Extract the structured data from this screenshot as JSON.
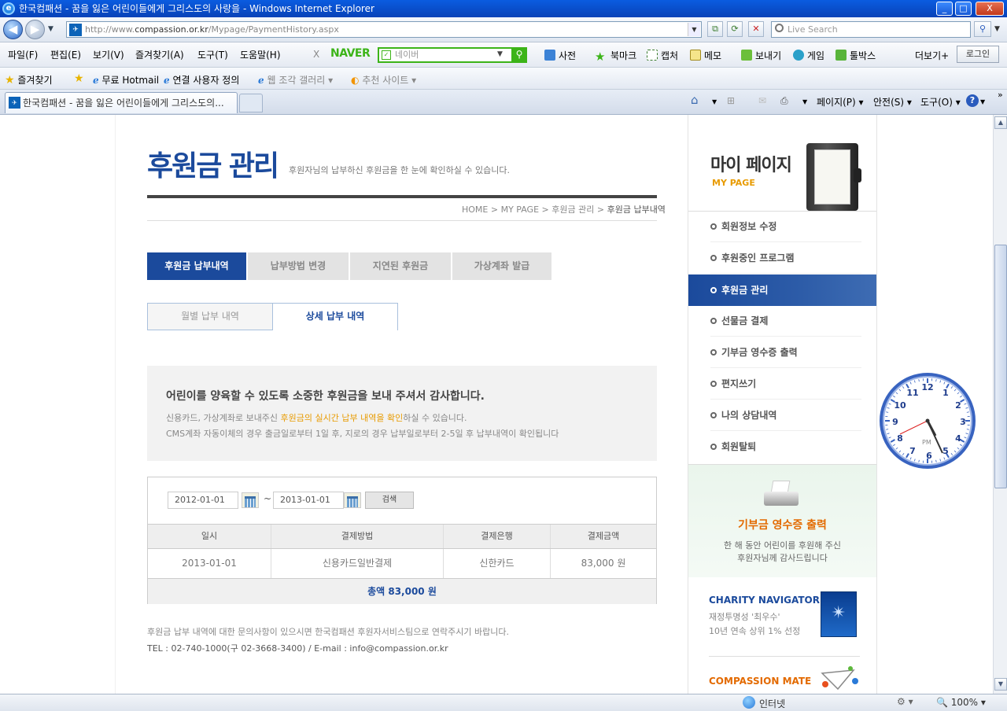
{
  "window": {
    "title": "한국컴패션 - 꿈을 잃은 어린이들에게 그리스도의 사랑을 - Windows Internet Explorer",
    "min": "_",
    "max": "□",
    "close": "X"
  },
  "address": {
    "url_pre": "http://www.",
    "url_host": "compassion.or.kr",
    "url_path": "/Mypage/PaymentHistory.aspx",
    "search_placeholder": "Live Search"
  },
  "menu": [
    "파일(F)",
    "편집(E)",
    "보기(V)",
    "즐겨찾기(A)",
    "도구(T)",
    "도움말(H)"
  ],
  "naver": {
    "close": "X",
    "logo": "NAVER",
    "placeholder": "네이버",
    "tools": [
      "사전",
      "북마크",
      "캡처",
      "메모",
      "보내기",
      "게임",
      "툴박스"
    ],
    "more": "더보기+",
    "login": "로그인"
  },
  "favorites": {
    "label": "즐겨찾기",
    "items": [
      "무료 Hotmail",
      "연결 사용자 정의",
      "웹 조각 갤러리",
      "추천 사이트"
    ]
  },
  "tab": {
    "title": "한국컴패션 - 꿈을 잃은 어린이들에게 그리스도의...",
    "commands": [
      "페이지(P)",
      "안전(S)",
      "도구(O)"
    ]
  },
  "page": {
    "title": "후원금 관리",
    "subtitle": "후원자님의 납부하신 후원금을 한 눈에 확인하실 수 있습니다.",
    "breadcrumb": [
      "HOME",
      "MY PAGE",
      "후원금 관리"
    ],
    "breadcrumb_current": "후원금 납부내역",
    "tabs": [
      "후원금 납부내역",
      "납부방법 변경",
      "지연된 후원금",
      "가상계좌 발급"
    ],
    "subtabs": [
      "월별 납부 내역",
      "상세 납부 내역"
    ],
    "notice": {
      "heading": "어린이를 양육할 수 있도록 소중한 후원금을 보내 주셔서 감사합니다.",
      "line1_pre": "신용카드, 가상계좌로 보내주신 ",
      "line1_highlight": "후원금의 실시간 납부 내역을 확인",
      "line1_post": "하실 수 있습니다.",
      "line2": "CMS계좌 자동이체의 경우 출금일로부터 1일 후, 지로의 경우 납부일로부터 2-5일 후 납부내역이 확인됩니다"
    },
    "filter": {
      "from": "2012-01-01",
      "to": "2013-01-01",
      "tilde": "~",
      "search_label": "검색"
    },
    "table": {
      "headers": [
        "일시",
        "결제방법",
        "결제은행",
        "결제금액"
      ],
      "rows": [
        [
          "2013-01-01",
          "신용카드일반결제",
          "신한카드",
          "83,000 원"
        ]
      ],
      "total": "총액  83,000 원"
    },
    "footer1": "후원금 납부 내역에 대한 문의사항이 있으시면 한국컴패션 후원자서비스팀으로 연락주시기 바랍니다.",
    "footer2": "TEL : 02-740-1000(구 02-3668-3400) / E-mail : info@compassion.or.kr"
  },
  "sidebar": {
    "title": "마이 페이지",
    "subtitle": "MY PAGE",
    "items": [
      "회원정보 수정",
      "후원중인 프로그램",
      "후원금 관리",
      "선물금 결제",
      "기부금 영수증 출력",
      "편지쓰기",
      "나의 상담내역",
      "회원탈퇴"
    ],
    "active_index": 2,
    "receipt": {
      "heading": "기부금 영수증 출력",
      "line1": "한 해 동안 어린이를 후원해 주신",
      "line2": "후원자님께 감사드립니다"
    },
    "charity": {
      "heading": "CHARITY NAVIGATOR",
      "line1": "재정투명성 '최우수'",
      "line2": "10년 연속 상위 1% 선정"
    },
    "mate": "COMPASSION MATE"
  },
  "clock": {
    "numbers": [
      "12",
      "1",
      "2",
      "3",
      "4",
      "5",
      "6",
      "7",
      "8",
      "9",
      "10",
      "11"
    ],
    "ampm": "PM"
  },
  "status": {
    "zone": "인터넷",
    "zoom": "100%"
  },
  "colors": {
    "brand_blue": "#1b4a9c",
    "accent_orange": "#e89b00",
    "naver_green": "#3cb418"
  }
}
